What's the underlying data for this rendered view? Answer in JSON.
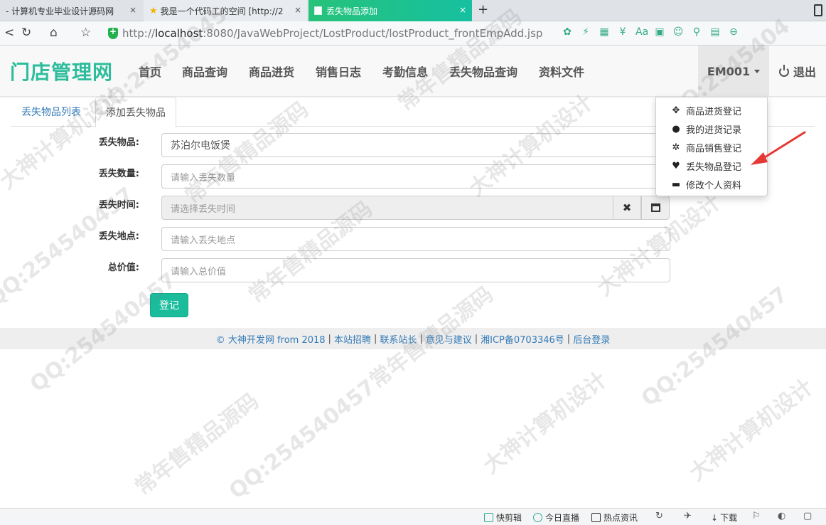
{
  "browser": {
    "tabs": [
      {
        "title": "- 计算机专业毕业设计源码网"
      },
      {
        "title": "我是一个代码工的空间 [http://2"
      },
      {
        "title": "丢失物品添加"
      }
    ],
    "new_tab": "+",
    "close_glyph": "×",
    "url_scheme": "http://",
    "url_host": "localhost",
    "url_rest": ":8080/JavaWebProject/LostProduct/lostProduct_frontEmpAdd.jsp"
  },
  "header": {
    "brand": "门店管理网",
    "nav": [
      "首页",
      "商品查询",
      "商品进货",
      "销售日志",
      "考勤信息",
      "丢失物品查询",
      "资料文件"
    ],
    "user": "EM001",
    "logout": "退出"
  },
  "dropdown": {
    "items": [
      {
        "label": "商品进货登记",
        "icon": "move-icon",
        "glyph": "✥"
      },
      {
        "label": "我的进货记录",
        "icon": "user-icon",
        "glyph": "●"
      },
      {
        "label": "商品销售登记",
        "icon": "cog-icon",
        "glyph": "✲"
      },
      {
        "label": "丢失物品登记",
        "icon": "heart-icon",
        "glyph": "♥"
      },
      {
        "label": "修改个人资料",
        "icon": "credit-card-icon",
        "glyph": "▬"
      }
    ]
  },
  "content_tabs": {
    "list": "丢失物品列表",
    "add": "添加丢失物品"
  },
  "form": {
    "name_label": "丢失物品:",
    "name_value": "苏泊尔电饭煲",
    "count_label": "丢失数量:",
    "count_placeholder": "请输入丢失数量",
    "time_label": "丢失时间:",
    "time_placeholder": "请选择丢失时间",
    "clear_glyph": "✖",
    "place_label": "丢失地点:",
    "place_placeholder": "请输入丢失地点",
    "price_label": "总价值:",
    "price_placeholder": "请输入总价值",
    "submit": "登记"
  },
  "footer": {
    "links": [
      "© 大神开发网 from 2018",
      "本站招聘",
      "联系站长",
      "意见与建议",
      "湘ICP备0703346号",
      "后台登录"
    ],
    "separator": "|"
  },
  "statusbar": {
    "items": [
      "快剪辑",
      "今日直播",
      "热点资讯",
      "下载"
    ]
  },
  "watermarks": [
    "QQ:25454045",
    "常年售精品源码",
    "大神计算机设计",
    "QQ:2545404",
    "常年售精品源码",
    "大神计算机设计",
    "QQ:254540457",
    "常年售精品源码",
    "大神计算机设计",
    "QQ:254540457",
    "常年售精品源码",
    "QQ:254540457",
    "大神计算机设计",
    "QQ:254540457",
    "常年售精品源码",
    "大神计算机设计"
  ],
  "colors": {
    "brand": "#2dbd9d",
    "submit": "#1abc9c",
    "link": "#337ab7",
    "arrow": "#e53935"
  }
}
